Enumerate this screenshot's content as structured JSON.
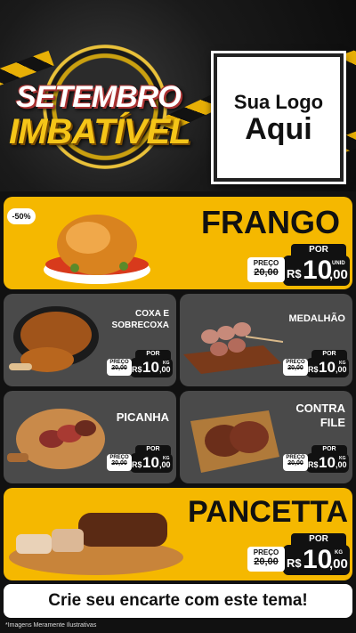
{
  "header": {
    "badge_line1": "SETEMBRO",
    "badge_line2": "IMBATÍVEL",
    "logo_line1": "Sua Logo",
    "logo_line2": "Aqui"
  },
  "products": {
    "frango": {
      "name": "FRANGO",
      "discount": "-50%",
      "por": "POR",
      "preco": "PREÇO",
      "old": "20,00",
      "currency": "R$",
      "int": "10",
      "cents": ",00",
      "unit": "UNID"
    },
    "coxa": {
      "name_line1": "COXA E",
      "name_line2": "SOBRECOXA",
      "por": "POR",
      "preco": "PREÇO",
      "old": "20,00",
      "currency": "R$",
      "int": "10",
      "cents": ",00",
      "unit": "KG"
    },
    "medalhao": {
      "name": "MEDALHÃO",
      "por": "POR",
      "preco": "PREÇO",
      "old": "20,00",
      "currency": "R$",
      "int": "10",
      "cents": ",00",
      "unit": "KG"
    },
    "picanha": {
      "name": "PICANHA",
      "por": "POR",
      "preco": "PREÇO",
      "old": "20,00",
      "currency": "R$",
      "int": "10",
      "cents": ",00",
      "unit": "KG"
    },
    "contrafile": {
      "name_line1": "CONTRA",
      "name_line2": "FILE",
      "por": "POR",
      "preco": "PREÇO",
      "old": "20,00",
      "currency": "R$",
      "int": "10",
      "cents": ",00",
      "unit": "KG"
    },
    "pancetta": {
      "name": "PANCETTA",
      "por": "POR",
      "preco": "PREÇO",
      "old": "20,00",
      "currency": "R$",
      "int": "10",
      "cents": ",00",
      "unit": "KG"
    }
  },
  "footer": {
    "cta": "Crie seu encarte com este tema!",
    "note": "*Imagens Meramente Ilustrativas"
  },
  "colors": {
    "accent": "#f5b800",
    "card_gray": "#4a4a4a",
    "dark": "#111111"
  }
}
